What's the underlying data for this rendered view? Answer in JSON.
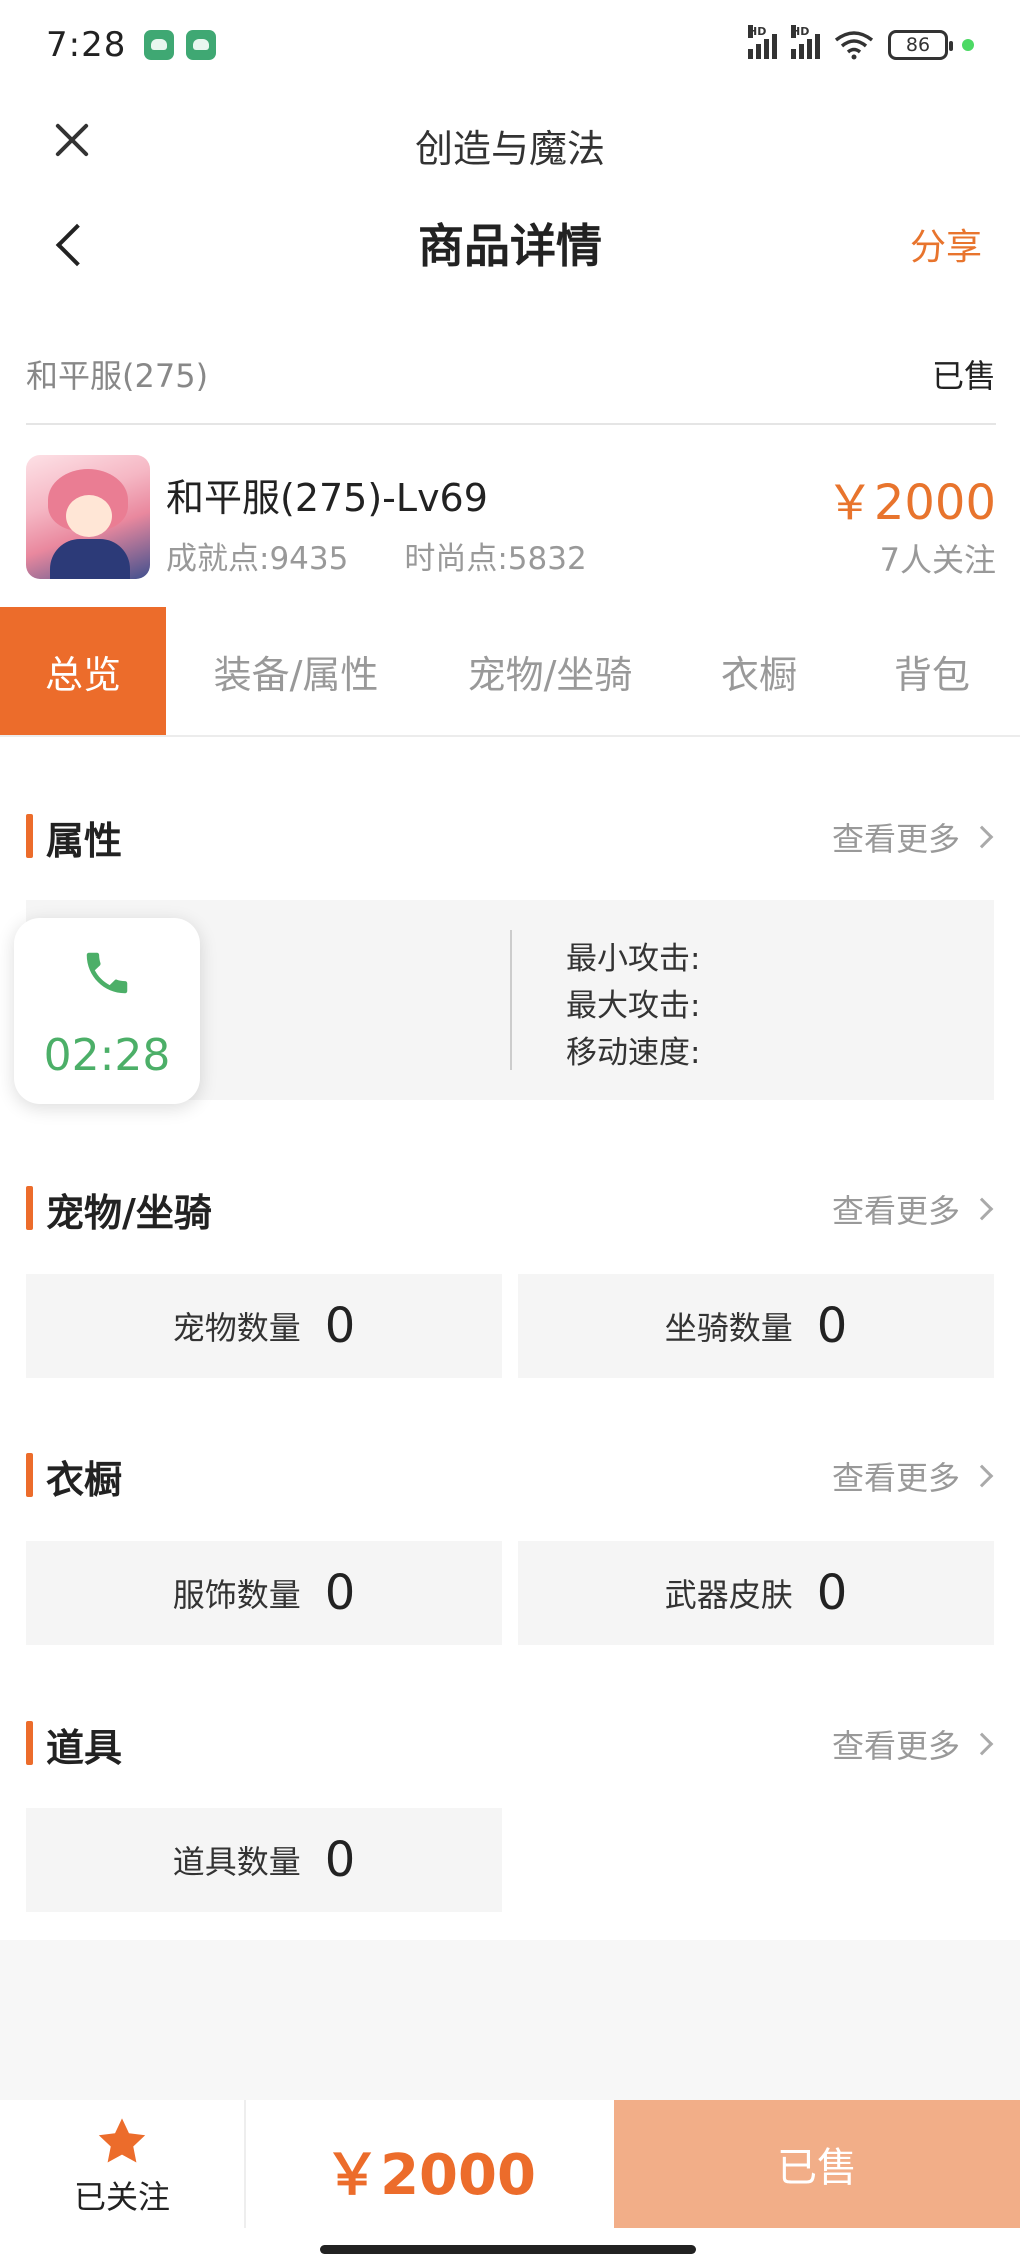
{
  "status_bar": {
    "time": "7:28",
    "network_badge": "HD",
    "battery": "86",
    "icons": [
      "android-icon",
      "wechat-icon",
      "signal-icon",
      "wifi-icon",
      "battery-icon"
    ]
  },
  "mini_bar": {
    "title": "创造与魔法",
    "close_icon": "close-icon"
  },
  "nav_bar": {
    "title": "商品详情",
    "share": "分享",
    "back_icon": "chevron-left-icon"
  },
  "server": {
    "name": "和平服(275)",
    "status": "已售"
  },
  "product": {
    "title": "和平服(275)-Lv69",
    "achievement": "成就点:9435",
    "fashion": "时尚点:5832",
    "price": "￥2000",
    "followers": "7人关注"
  },
  "tabs": [
    {
      "label": "总览",
      "active": true
    },
    {
      "label": "装备/属性",
      "active": false
    },
    {
      "label": "宠物/坐骑",
      "active": false
    },
    {
      "label": "衣橱",
      "active": false
    },
    {
      "label": "背包",
      "active": false
    }
  ],
  "view_more": "查看更多",
  "sections": {
    "attributes": {
      "title": "属性",
      "items": [
        "最小攻击:",
        "最大攻击:",
        "移动速度:"
      ]
    },
    "pets": {
      "title": "宠物/坐骑",
      "stats": [
        {
          "label": "宠物数量",
          "value": "0"
        },
        {
          "label": "坐骑数量",
          "value": "0"
        }
      ]
    },
    "wardrobe": {
      "title": "衣橱",
      "stats": [
        {
          "label": "服饰数量",
          "value": "0"
        },
        {
          "label": "武器皮肤",
          "value": "0"
        }
      ]
    },
    "items": {
      "title": "道具",
      "stats": [
        {
          "label": "道具数量",
          "value": "0"
        }
      ]
    }
  },
  "call_overlay": {
    "time": "02:28",
    "color": "#4caf68"
  },
  "bottom_bar": {
    "follow_label": "已关注",
    "price": "￥2000",
    "buy_label": "已售"
  },
  "colors": {
    "accent": "#ec6c2b",
    "accent_light": "#f2ae88",
    "muted_text": "#999999"
  }
}
